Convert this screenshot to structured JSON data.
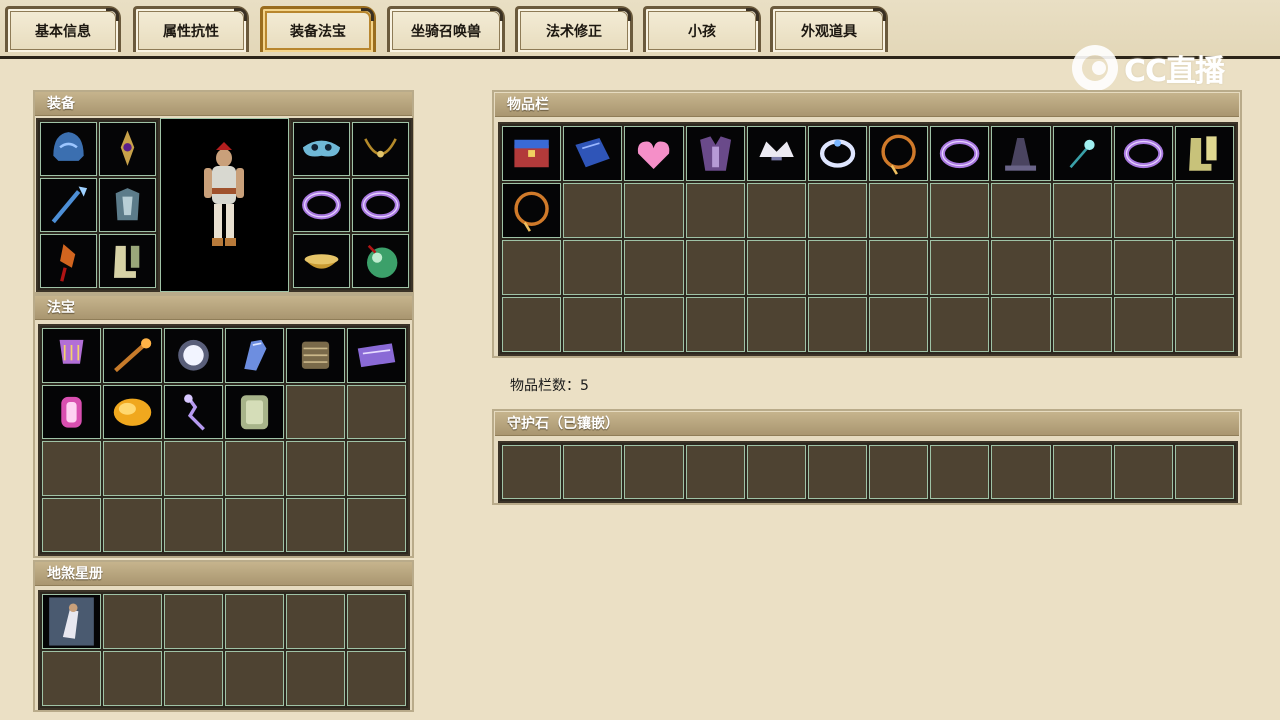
{
  "tabs": [
    {
      "label": "基本信息",
      "active": false
    },
    {
      "label": "属性抗性",
      "active": false
    },
    {
      "label": "装备法宝",
      "active": true
    },
    {
      "label": "坐骑召唤兽",
      "active": false
    },
    {
      "label": "法术修正",
      "active": false
    },
    {
      "label": "小孩",
      "active": false
    },
    {
      "label": "外观道具",
      "active": false
    }
  ],
  "logo": {
    "text": "CC直播"
  },
  "equipment": {
    "title": "装备",
    "left_slots": [
      "helmet-icon",
      "amulet-icon",
      "spear-icon",
      "armor-icon",
      "tassel-pendant-icon",
      "boots-icon"
    ],
    "right_slots": [
      "mask-icon",
      "gold-necklace-icon",
      "purple-ring-icon",
      "purple-ring-icon",
      "gold-bowl-icon",
      "green-orb-icon"
    ]
  },
  "treasures": {
    "title": "法宝",
    "items": [
      "lyre-icon",
      "staff-icon",
      "mirror-icon",
      "gauntlet-icon",
      "scroll-bundle-icon",
      "purple-scroll-icon",
      "lantern-icon",
      "golden-cloud-icon",
      "purple-spirit-icon",
      "jade-seal-icon"
    ],
    "total_slots": 24
  },
  "star_book": {
    "title": "地煞星册",
    "items": [
      "warrior-card-icon"
    ],
    "total_slots": 12
  },
  "inventory": {
    "title": "物品栏",
    "items": [
      "chest-icon",
      "blue-book-icon",
      "pink-heart-icon",
      "purple-robe-icon",
      "white-tiara-icon",
      "silver-ring-icon",
      "fire-necklace-icon",
      "purple-ring-icon",
      "stone-altar-icon",
      "magic-wand-icon",
      "purple-ring-icon",
      "golden-boots-icon",
      "fire-necklace-icon"
    ],
    "total_slots": 48,
    "count_label": "物品栏数：",
    "count_value": "5"
  },
  "guard_stones": {
    "title": "守护石（已镶嵌）",
    "items": [],
    "total_slots": 12
  }
}
